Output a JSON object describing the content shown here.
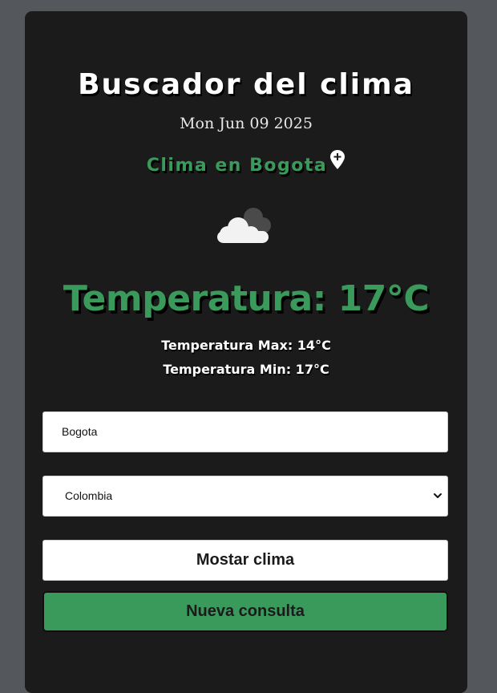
{
  "app": {
    "title": "Buscador del clima",
    "date": "Mon Jun 09 2025",
    "location_label": "Clima en Bogota"
  },
  "weather": {
    "icon": "cloudy-icon",
    "temperature_label": "Temperatura: 17°C",
    "max_label": "Temperatura Max: 14°C",
    "min_label": "Temperatura Min: 17°C"
  },
  "form": {
    "city_value": "Bogota",
    "country_selected": "Colombia",
    "show_button_label": "Mostar clima",
    "new_query_button_label": "Nueva consulta"
  },
  "colors": {
    "background": "#54575c",
    "card": "#1b1b1b",
    "accent_green": "#3a9a5b",
    "text_white": "#ffffff"
  },
  "icons": {
    "location": "map-pin-plus-icon",
    "dropdown": "chevron-down-icon"
  }
}
